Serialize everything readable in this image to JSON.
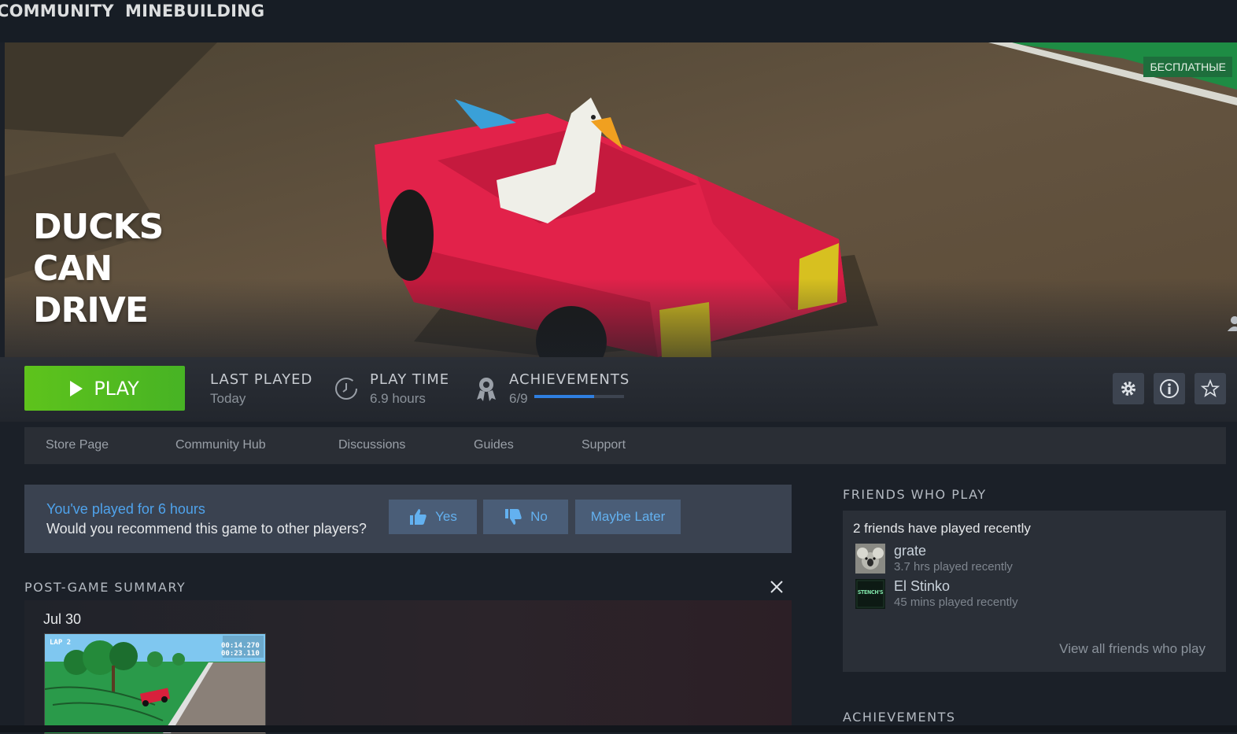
{
  "nav": {
    "community": "COMMUNITY",
    "username": "MINEBUILDING"
  },
  "hero": {
    "title_lines": [
      "DUCKS",
      "CAN",
      "DRIVE"
    ],
    "badge": "БЕСПЛАТНЫЕ",
    "icons": [
      "user-icon",
      "friends-icon"
    ]
  },
  "actions": {
    "play_label": "PLAY",
    "last_played": {
      "label": "LAST PLAYED",
      "value": "Today"
    },
    "play_time": {
      "label": "PLAY TIME",
      "value": "6.9 hours"
    },
    "achievements": {
      "label": "ACHIEVEMENTS",
      "value": "6/9",
      "progress": 0.667
    },
    "icons": [
      "gear-icon",
      "info-icon",
      "star-icon"
    ]
  },
  "tabs": [
    "Store Page",
    "Community Hub",
    "Discussions",
    "Guides",
    "Support"
  ],
  "recommend": {
    "played_text": "You've played for 6 hours",
    "question": "Would you recommend this game to other players?",
    "yes": "Yes",
    "no": "No",
    "later": "Maybe Later"
  },
  "post_game": {
    "title": "POST-GAME SUMMARY",
    "date": "Jul 30",
    "screenshot_overlay": {
      "lap": "LAP 2",
      "time1": "00:14.270",
      "time2": "00:23.110"
    }
  },
  "friends": {
    "title": "FRIENDS WHO PLAY",
    "count_text": "2 friends have played recently",
    "list": [
      {
        "name": "grate",
        "sub": "3.7 hrs played recently"
      },
      {
        "name": "El Stinko",
        "sub": "45 mins played recently",
        "avatar_text": "STENCH'S"
      }
    ],
    "view_all": "View all friends who play"
  },
  "achievements_title": "ACHIEVEMENTS",
  "colors": {
    "play_green": "#5ec31c",
    "accent_blue": "#2f7fe0",
    "link_blue": "#4fa3ec",
    "badge_green": "#1e6e3c"
  }
}
